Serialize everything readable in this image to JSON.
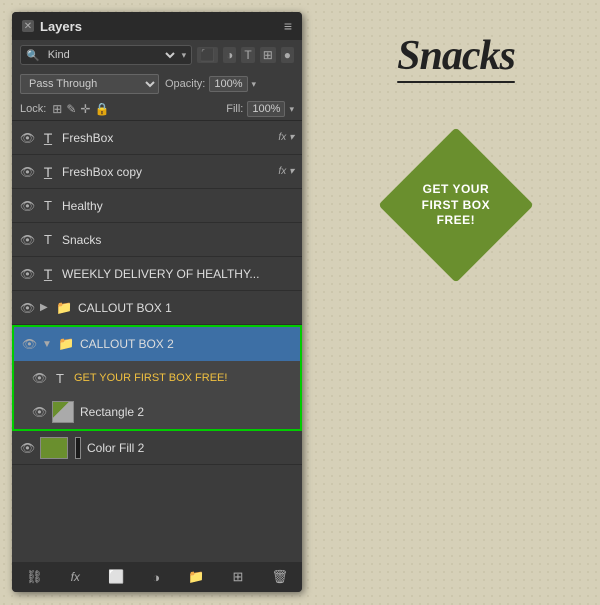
{
  "panel": {
    "title": "Layers",
    "menu_icon": "≡",
    "close_x": "✕",
    "filter": {
      "label": "Kind",
      "placeholder": "Kind",
      "icons": [
        "⬛",
        "◑",
        "T",
        "⊞",
        "◉"
      ]
    },
    "blend": {
      "mode": "Pass Through",
      "opacity_label": "Opacity:",
      "opacity_value": "100%",
      "dropdown_arrow": "▾"
    },
    "lock": {
      "label": "Lock:",
      "icons": [
        "⊞",
        "✎",
        "↔",
        "🔒"
      ],
      "fill_label": "Fill:",
      "fill_value": "100%"
    },
    "layers": [
      {
        "id": "freshbox",
        "name": "FreshBox",
        "type": "text-warped",
        "eye": true,
        "fx": true,
        "indent": 0
      },
      {
        "id": "freshbox-copy",
        "name": "FreshBox copy",
        "type": "text-warped",
        "eye": true,
        "fx": true,
        "indent": 0
      },
      {
        "id": "healthy",
        "name": "Healthy",
        "type": "text",
        "eye": true,
        "indent": 0
      },
      {
        "id": "snacks",
        "name": "Snacks",
        "type": "text",
        "eye": true,
        "indent": 0
      },
      {
        "id": "weekly",
        "name": "WEEKLY DELIVERY OF HEALTHY...",
        "type": "text-warped",
        "eye": true,
        "indent": 0
      },
      {
        "id": "callout1",
        "name": "CALLOUT BOX 1",
        "type": "folder",
        "eye": true,
        "expanded": false,
        "indent": 0
      },
      {
        "id": "callout2",
        "name": "CALLOUT BOX 2",
        "type": "folder",
        "eye": true,
        "expanded": true,
        "selected_group": true,
        "indent": 0
      },
      {
        "id": "getyourfirst",
        "name": "GET YOUR FIRST BOX FREE!",
        "type": "text",
        "eye": true,
        "indent": 1,
        "in_group": true
      },
      {
        "id": "rect2",
        "name": "Rectangle 2",
        "type": "thumb",
        "eye": true,
        "indent": 1,
        "in_group": true
      },
      {
        "id": "colorfill",
        "name": "Color Fill 2",
        "type": "colorfill-thumb",
        "eye": true,
        "indent": 0
      }
    ],
    "footer": {
      "icons": [
        "⛓",
        "fx",
        "⬜",
        "◑",
        "📁",
        "⊞",
        "🗑"
      ]
    }
  },
  "right": {
    "logo_text": "Snacks",
    "badge_line1": "GET YOUR",
    "badge_line2": "FIRST BOX",
    "badge_line3": "FREE!"
  }
}
